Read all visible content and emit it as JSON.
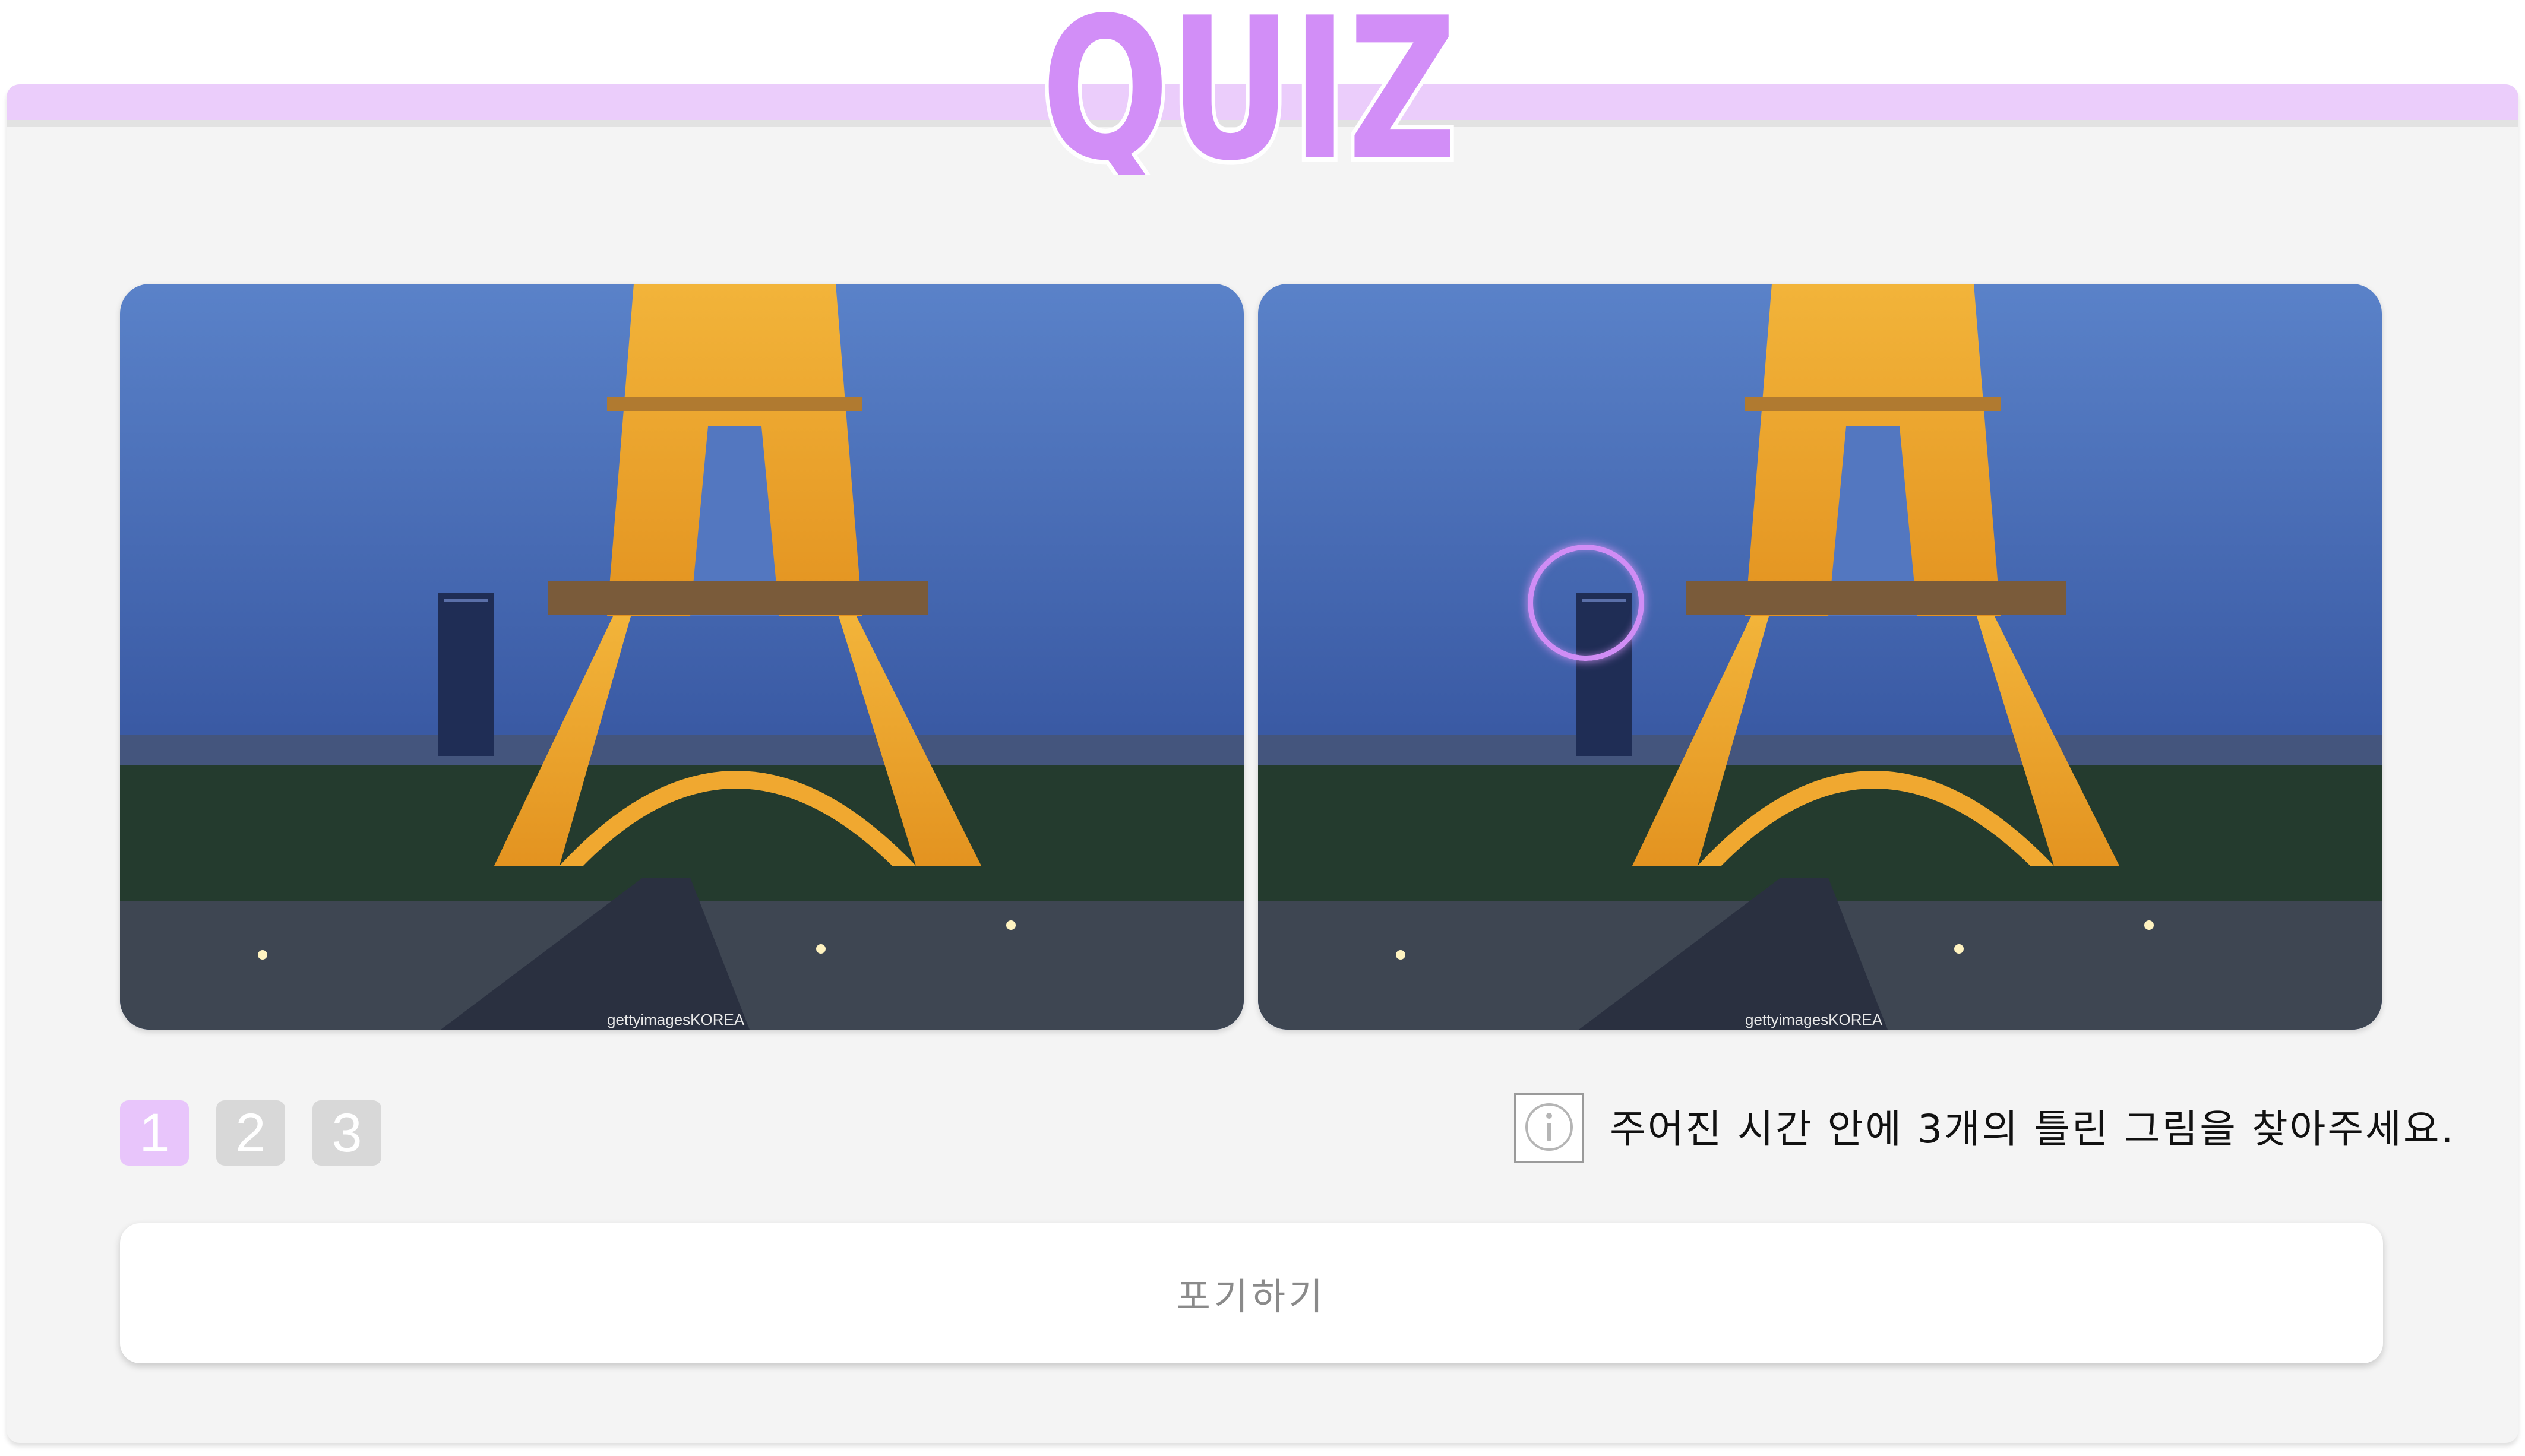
{
  "header": {
    "title": "QUIZ"
  },
  "colors": {
    "accent": "#d28ef7",
    "accent_light": "#ebcdfb",
    "panel_bg": "#f4f4f4",
    "step_inactive": "#d8d8d8"
  },
  "images": {
    "left_watermark": "gettyimagesKOREA",
    "right_watermark": "gettyimagesKOREA"
  },
  "quiz": {
    "steps": [
      "1",
      "2",
      "3"
    ],
    "active_step": "1",
    "info_icon": "info-circle-icon",
    "instruction": "주어진 시간 안에 3개의 틀린 그림을 찾아주세요.",
    "giveup_label": "포기하기"
  }
}
